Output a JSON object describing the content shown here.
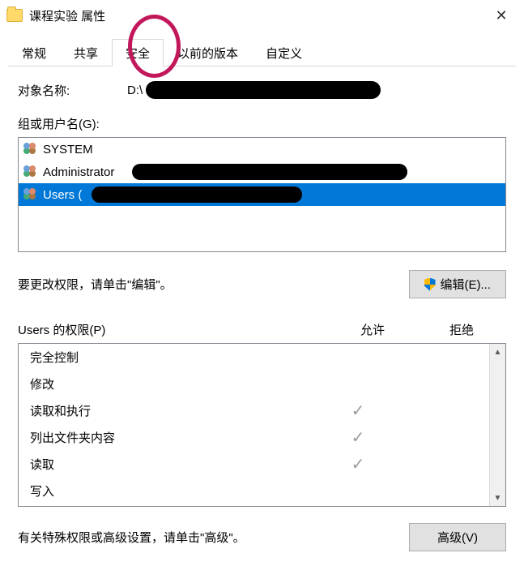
{
  "window": {
    "title": "课程实验 属性"
  },
  "tabs": {
    "general": "常规",
    "sharing": "共享",
    "security": "安全",
    "previous": "以前的版本",
    "customize": "自定义",
    "active": "security"
  },
  "security": {
    "object_label": "对象名称:",
    "object_path_prefix": "D:\\",
    "groups_label": "组或用户名(G):",
    "principals": [
      {
        "name": "SYSTEM",
        "redacted": false
      },
      {
        "name": "Administrator",
        "redacted": true
      },
      {
        "name": "Users (",
        "redacted": true,
        "selected": true
      }
    ],
    "edit_hint": "要更改权限，请单击\"编辑\"。",
    "edit_button": "编辑(E)...",
    "perm_for_label": "Users 的权限(P)",
    "allow_label": "允许",
    "deny_label": "拒绝",
    "permissions": [
      {
        "name": "完全控制",
        "allow": false,
        "deny": false
      },
      {
        "name": "修改",
        "allow": false,
        "deny": false
      },
      {
        "name": "读取和执行",
        "allow": true,
        "deny": false
      },
      {
        "name": "列出文件夹内容",
        "allow": true,
        "deny": false
      },
      {
        "name": "读取",
        "allow": true,
        "deny": false
      },
      {
        "name": "写入",
        "allow": false,
        "deny": false
      }
    ],
    "advanced_hint": "有关特殊权限或高级设置，请单击\"高级\"。",
    "advanced_button": "高级(V)"
  }
}
